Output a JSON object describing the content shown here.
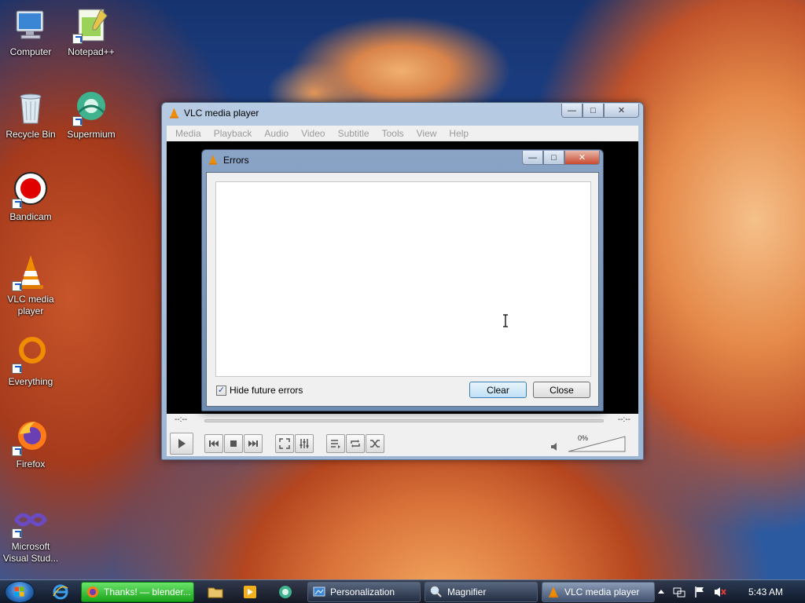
{
  "desktop": {
    "icons": [
      {
        "label": "Computer"
      },
      {
        "label": "Notepad++"
      },
      {
        "label": "Recycle Bin"
      },
      {
        "label": "Supermium"
      },
      {
        "label": "Bandicam"
      },
      {
        "label": "VLC media player"
      },
      {
        "label": "Everything"
      },
      {
        "label": "Firefox"
      },
      {
        "label": "Microsoft Visual Stud..."
      }
    ]
  },
  "vlc": {
    "title": "VLC media player",
    "menu": [
      "Media",
      "Playback",
      "Audio",
      "Video",
      "Subtitle",
      "Tools",
      "View",
      "Help"
    ],
    "time_elapsed": "--:--",
    "time_total": "--:--",
    "volume": "0%"
  },
  "errors_dialog": {
    "title": "Errors",
    "hide_future_errors_label": "Hide future errors",
    "hide_future_errors_checked": true,
    "clear_label": "Clear",
    "close_label": "Close"
  },
  "taskbar": {
    "buttons": [
      {
        "label": "Thanks! — blender..."
      },
      {
        "label": "Personalization"
      },
      {
        "label": "Magnifier"
      },
      {
        "label": "VLC media player"
      }
    ],
    "clock": "5:43 AM"
  },
  "colors": {
    "accent_green": "#1aa31a",
    "vlc_orange": "#f08c00",
    "record_red": "#e00000"
  }
}
